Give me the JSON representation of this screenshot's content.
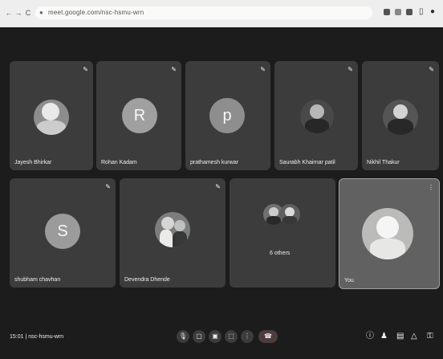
{
  "browser": {
    "url": "meet.google.com/nsc-hsmu-wrn"
  },
  "participants": [
    {
      "name": "Jayesh Bhirkar",
      "avatar": "photo"
    },
    {
      "name": "Rohan Kadam",
      "avatar": "letter",
      "letter": "R",
      "color": "#9e9e9e"
    },
    {
      "name": "prathamesh kurwar",
      "avatar": "letter",
      "letter": "p",
      "color": "#8d8d8d"
    },
    {
      "name": "Saurabh Khairnar patil",
      "avatar": "photo"
    },
    {
      "name": "Nikhil Thakur",
      "avatar": "photo"
    },
    {
      "name": "shubham chavhan",
      "avatar": "letter",
      "letter": "S",
      "color": "#9a9a9a"
    },
    {
      "name": "Devendra Dhende",
      "avatar": "photo"
    },
    {
      "name": "6 others",
      "avatar": "group"
    },
    {
      "name": "You",
      "avatar": "photo"
    }
  ],
  "bottom_bar": {
    "time": "15:01",
    "meeting_code": "nsc-hsmu-wrn"
  },
  "icons": {
    "mic": "mic-icon",
    "camera": "camera-icon",
    "captions": "captions-icon",
    "present": "present-icon",
    "more": "more-options-icon",
    "end_call": "end-call-icon",
    "info": "info-icon",
    "people": "people-icon",
    "chat": "chat-icon",
    "activities": "activities-icon",
    "host": "host-controls-icon"
  }
}
